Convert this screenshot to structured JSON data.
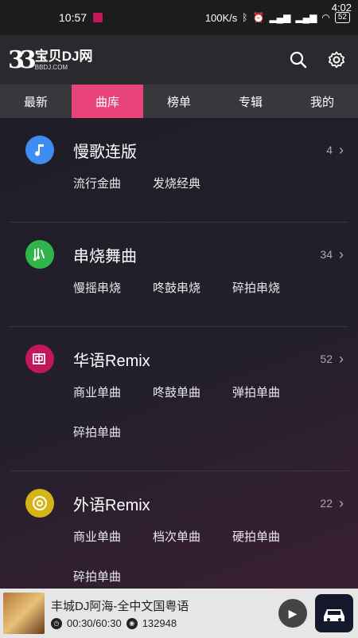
{
  "status_bar": {
    "time": "10:57",
    "speed": "100K/s",
    "right_time": "4:02",
    "battery": "52"
  },
  "header": {
    "logo_mark": "33",
    "logo_title": "宝贝DJ网",
    "logo_sub": "BBDJ.COM",
    "icons": [
      "search-icon",
      "gear-icon"
    ]
  },
  "tabs": [
    {
      "label": "最新",
      "active": false
    },
    {
      "label": "曲库",
      "active": true
    },
    {
      "label": "榜单",
      "active": false
    },
    {
      "label": "专辑",
      "active": false
    },
    {
      "label": "我的",
      "active": false
    }
  ],
  "categories": [
    {
      "title": "慢歌连版",
      "count": "4",
      "icon": "music-note-icon",
      "color": "#3d8ef0",
      "tags": [
        "流行金曲",
        "发烧经典"
      ]
    },
    {
      "title": "串烧舞曲",
      "count": "34",
      "icon": "dance-icon",
      "color": "#2fb54a",
      "tags": [
        "慢摇串烧",
        "咚鼓串烧",
        "碎拍串烧"
      ]
    },
    {
      "title": "华语Remix",
      "count": "52",
      "icon": "chinese-char-icon",
      "color": "#c2185b",
      "tags": [
        "商业单曲",
        "咚鼓单曲",
        "弹拍单曲",
        "碎拍单曲"
      ]
    },
    {
      "title": "外语Remix",
      "count": "22",
      "icon": "record-icon",
      "color": "#d4b418",
      "tags": [
        "商业单曲",
        "档次单曲",
        "硬拍单曲",
        "碎拍单曲"
      ]
    }
  ],
  "player": {
    "song_title": "丰城DJ阿海-全中文国粤语",
    "time": "00:30/60:30",
    "plays": "132948"
  },
  "colors": {
    "accent": "#e8447a",
    "header_bg": "#2a2a2e",
    "tabs_bg": "#38383c"
  }
}
